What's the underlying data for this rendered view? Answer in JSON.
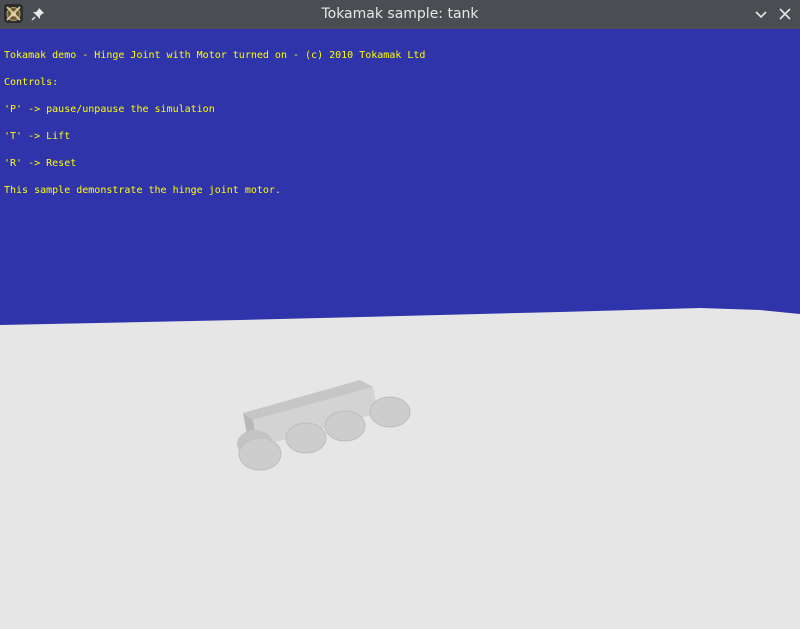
{
  "window": {
    "title": "Tokamak sample: tank",
    "icons": {
      "app": "tokamak-app-icon",
      "pin": "pin-icon",
      "minimize": "chevron-down-icon",
      "close": "close-icon"
    }
  },
  "overlay": {
    "color": "#ffff00",
    "lines": [
      "Tokamak demo - Hinge Joint with Motor turned on - (c) 2010 Tokamak Ltd",
      "Controls:",
      "'P' -> pause/unpause the simulation",
      "'T' -> Lift",
      "'R' -> Reset",
      "This sample demonstrate the hinge joint motor."
    ]
  },
  "scene": {
    "sky_color": "#2f34ab",
    "ground_color": "#e6e6e6",
    "tank_color": "#cfcfcf"
  }
}
